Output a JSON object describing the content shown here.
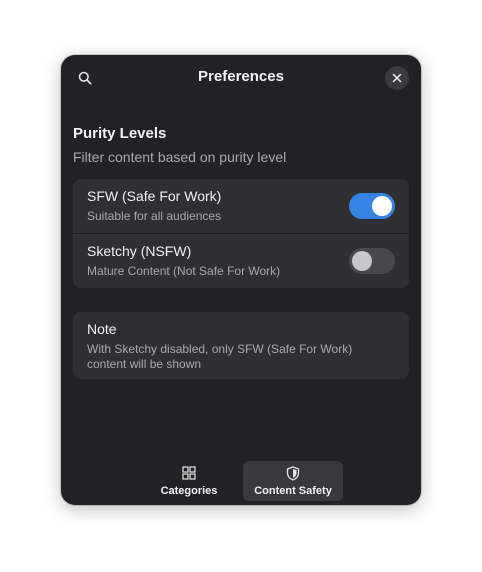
{
  "header": {
    "title": "Preferences",
    "search_icon": "search-icon",
    "close_icon": "close-icon"
  },
  "purity": {
    "title": "Purity Levels",
    "subtitle": "Filter content based on purity level",
    "items": [
      {
        "title": "SFW (Safe For Work)",
        "subtitle": "Suitable for all audiences",
        "enabled": true
      },
      {
        "title": "Sketchy (NSFW)",
        "subtitle": "Mature Content (Not Safe For Work)",
        "enabled": false
      }
    ]
  },
  "note": {
    "title": "Note",
    "text": "With Sketchy disabled, only SFW (Safe For Work) content will be shown"
  },
  "tabs": [
    {
      "label": "Categories",
      "icon": "grid-icon",
      "active": false
    },
    {
      "label": "Content Safety",
      "icon": "shield-icon",
      "active": true
    }
  ],
  "colors": {
    "window_bg": "#222226",
    "card_bg": "#2e2e33",
    "accent": "#3584e4"
  }
}
